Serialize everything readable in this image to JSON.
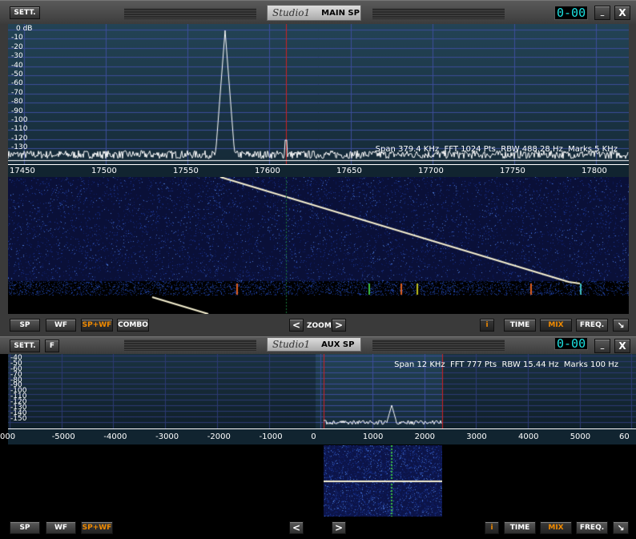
{
  "main": {
    "settings_label": "SETT.",
    "logo_text": "Studio1",
    "window_label": "MAIN SP",
    "counter": "0-00",
    "minimize_label": "_",
    "close_label": "X",
    "y_labels": [
      "0 dB",
      "-10",
      "-20",
      "-30",
      "-40",
      "-50",
      "-60",
      "-70",
      "-80",
      "-90",
      "-100",
      "-110",
      "-120",
      "-130"
    ],
    "x_labels": [
      "17450",
      "17500",
      "17550",
      "17600",
      "17650",
      "17700",
      "17750",
      "17800"
    ],
    "info": {
      "span": "Span 379.4 KHz",
      "fft": "FFT 1024 Pts",
      "rbw": "RBW 488.28 Hz",
      "marks": "Marks 5 KHz"
    },
    "buttons": {
      "sp": "SP",
      "wf": "WF",
      "spwf": "SP+WF",
      "combo": "COMBO",
      "zoom_prev": "<",
      "zoom": "ZOOM",
      "zoom_next": ">",
      "info": "i",
      "time": "TIME",
      "mix": "MIX",
      "freq": "FREQ.",
      "resize": "↘"
    },
    "active_mode": "SP+WF"
  },
  "aux": {
    "settings_label": "SETT.",
    "f_label": "F",
    "logo_text": "Studio1",
    "window_label": "AUX SP",
    "counter": "0-00",
    "minimize_label": "_",
    "close_label": "X",
    "y_labels": [
      "-30",
      "-40",
      "-50",
      "-60",
      "-70",
      "-80",
      "-90",
      "-100",
      "-110",
      "-120",
      "-130",
      "-140",
      "-150"
    ],
    "x_labels": [
      "000",
      "-5000",
      "-4000",
      "-3000",
      "-2000",
      "-1000",
      "0",
      "1000",
      "2000",
      "3000",
      "4000",
      "5000",
      "60"
    ],
    "info": {
      "span": "Span 12 KHz",
      "fft": "FFT 777 Pts",
      "rbw": "RBW 15.44 Hz",
      "marks": "Marks 100 Hz"
    },
    "buttons": {
      "sp": "SP",
      "wf": "WF",
      "spwf": "SP+WF",
      "prev": "<",
      "next": ">",
      "info": "i",
      "time": "TIME",
      "mix": "MIX",
      "freq": "FREQ.",
      "resize": "↘"
    },
    "active_mode": "SP+WF"
  },
  "colors": {
    "marker": "#d02020",
    "trace": "#ffffff",
    "digits": "#1ce0e0",
    "active": "#f08a00"
  }
}
